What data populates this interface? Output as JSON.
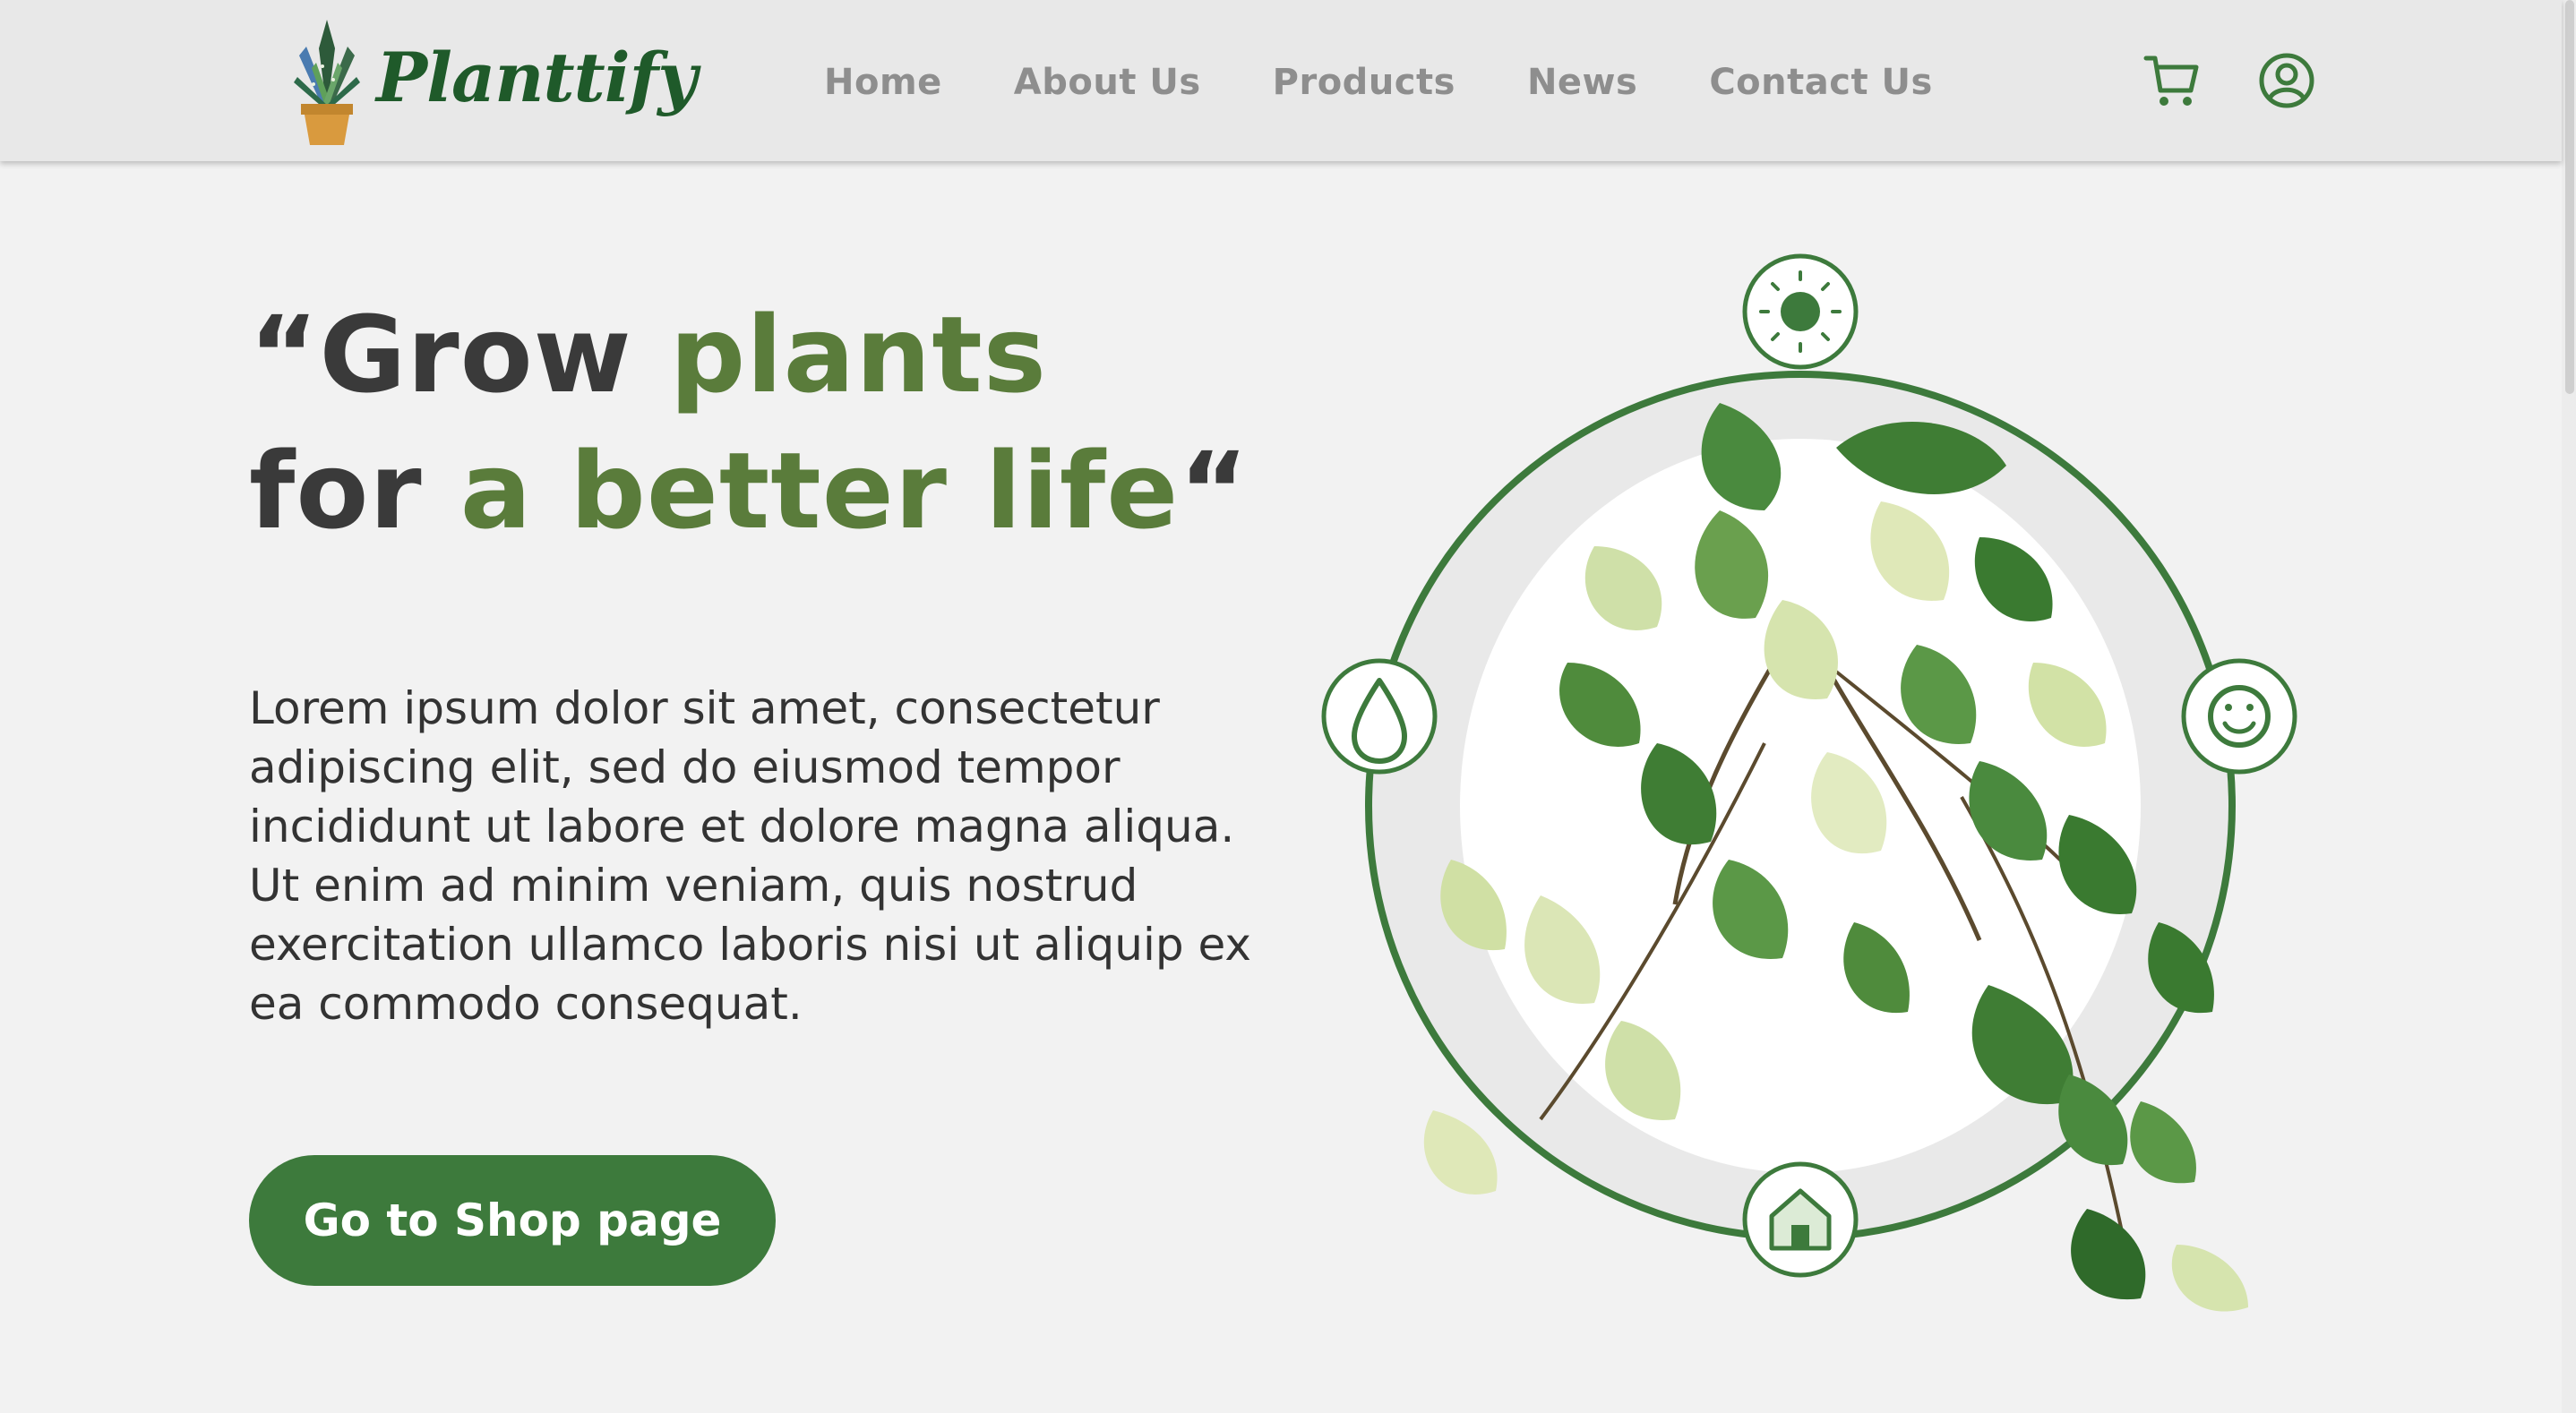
{
  "brand": {
    "name": "Planttify"
  },
  "nav": {
    "links": [
      "Home",
      "About Us",
      "Products",
      "News",
      "Contact Us"
    ],
    "icons": [
      "cart-icon",
      "user-account-icon"
    ]
  },
  "hero": {
    "headline": {
      "line1_a": "“Grow ",
      "line1_b": "plants",
      "line2_a": "for ",
      "line2_b": "a better life",
      "line2_c": "“"
    },
    "body": "Lorem ipsum dolor sit amet, consectetur adipiscing elit, sed do eiusmod tempor incididunt ut labore et dolore magna aliqua. Ut enim ad minim veniam, quis nostrud exercitation ullamco laboris nisi ut aliquip ex ea commodo consequat.",
    "cta_label": "Go to Shop page",
    "feature_icons": [
      "sun-icon",
      "water-drop-icon",
      "smiley-icon",
      "house-icon"
    ]
  },
  "colors": {
    "accent_green": "#3d7a3c",
    "headline_green": "#5a7c3b",
    "nav_text": "#8e8e8e",
    "navbar_bg": "#e8e8e8",
    "page_bg": "#f2f2f2"
  }
}
